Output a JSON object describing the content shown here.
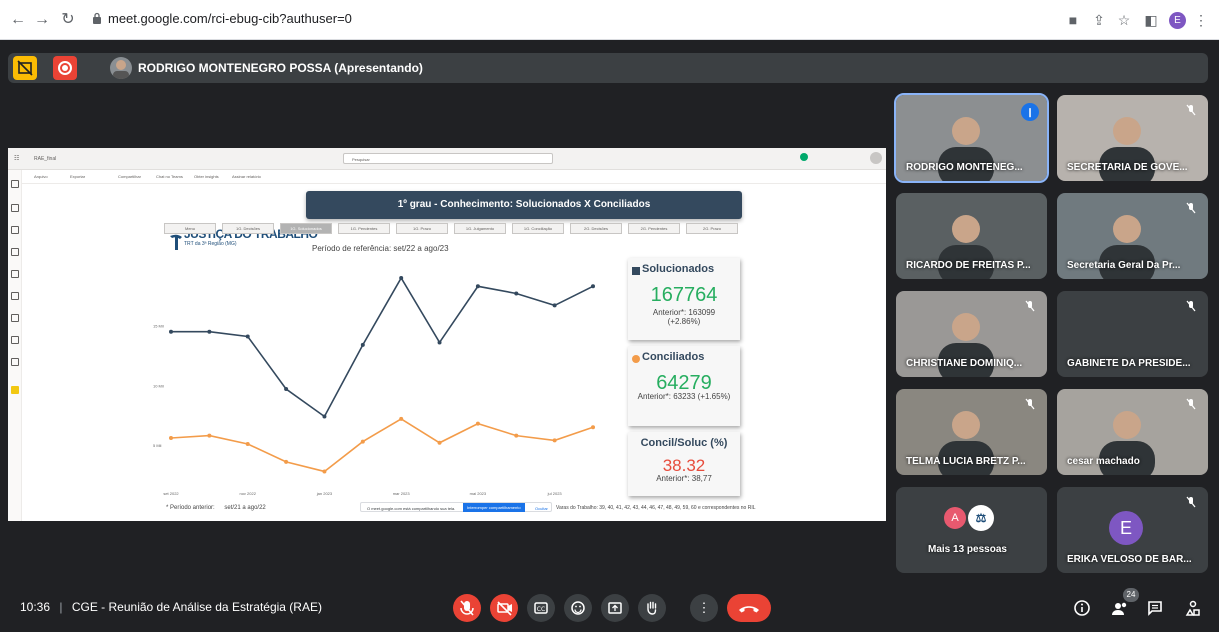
{
  "browser": {
    "url": "meet.google.com/rci-ebug-cib?authuser=0",
    "profile_initial": "E"
  },
  "presenter": {
    "label": "RODRIGO MONTENEGRO POSSA (Apresentando)"
  },
  "report": {
    "app_tab": "RAE_final",
    "search_placeholder": "Pesquisar",
    "toolbar_items": [
      "Arquivo",
      "Exportar",
      "Compartilhar",
      "Chat no Teams",
      "Obter insights",
      "Assinar relatório"
    ],
    "logo_title": "JUSTIÇA DO TRABALHO",
    "logo_subtitle": "TRT da 3ª Região (MG)",
    "header": "1º grau - Conhecimento: Solucionados X Conciliados",
    "tabs": [
      "Menu",
      "1G. Decisões",
      "1G. Solucionados",
      "1G. Pendentes",
      "1G. Prazo",
      "1G. Julgamento",
      "1G. Conciliação",
      "2G. Decisões",
      "2G. Pendentes",
      "2G. Prazo"
    ],
    "period_label": "Período de referência:",
    "period_value": "set/22 a ago/23",
    "anterior_label": "* Período anterior:",
    "anterior_value": "set/21 a ago/22",
    "footer_note": "Varas do Trabalho: 39, 40, 41, 42, 43, 44, 46, 47, 48, 49, 59, 60 e correspondentes no RIL",
    "share_notice": "O meet.google.com está compartilhando sua tela.",
    "share_stop": "Interromper compartilhamento",
    "share_hide": "Ocultar",
    "solucionados": {
      "title": "Solucionados",
      "value": "167764",
      "anterior": "Anterior*: 163099",
      "delta": "(+2.86%)"
    },
    "conciliados": {
      "title": "Conciliados",
      "value": "64279",
      "anterior": "Anterior*: 63233 (+1.65%)"
    },
    "ratio": {
      "title": "Concil/Soluc (%)",
      "value": "38.32",
      "anterior": "Anterior*: 38,77"
    },
    "colors": {
      "solucionados": "#34495e",
      "conciliados": "#f39c4a",
      "ratio": "#e74c3c",
      "green": "#27ae60"
    }
  },
  "chart_data": {
    "type": "line",
    "x": [
      "set 2022",
      "out 2022",
      "nov 2022",
      "dez 2022",
      "jan 2023",
      "fev 2023",
      "mar 2023",
      "abr 2023",
      "mai 2023",
      "jun 2023",
      "jul 2023",
      "ago 2023"
    ],
    "x_tick_labels": [
      "set 2022",
      "nov 2022",
      "jan 2023",
      "mar 2023",
      "mai 2023",
      "jul 2023"
    ],
    "y_tick_labels": [
      "5 Mil",
      "10 Mil",
      "15 Mil"
    ],
    "ylim": [
      2000,
      20000
    ],
    "series": [
      {
        "name": "Solucionados",
        "color": "#34495e",
        "values": [
          14500,
          14500,
          14100,
          9700,
          7400,
          13400,
          19000,
          13600,
          18300,
          17700,
          16700,
          18300
        ]
      },
      {
        "name": "Conciliados",
        "color": "#f39c4a",
        "values": [
          5600,
          5800,
          5100,
          3600,
          2800,
          5300,
          7200,
          5200,
          6800,
          5800,
          5400,
          6500
        ]
      }
    ]
  },
  "participants": [
    {
      "name": "RODRIGO MONTENEG...",
      "muted": false,
      "speaking": true
    },
    {
      "name": "SECRETARIA DE GOVE...",
      "muted": true
    },
    {
      "name": "RICARDO DE FREITAS P...",
      "muted": false
    },
    {
      "name": "Secretaria Geral Da Pr...",
      "muted": true
    },
    {
      "name": "CHRISTIANE DOMINIQ...",
      "muted": true
    },
    {
      "name": "GABINETE DA PRESIDE...",
      "muted": true
    },
    {
      "name": "TELMA LUCIA BRETZ P...",
      "muted": true
    },
    {
      "name": "cesar machado",
      "muted": true
    },
    {
      "name": "Mais 13 pessoas",
      "muted": false
    },
    {
      "name": "ERIKA VELOSO DE BAR...",
      "muted": true
    }
  ],
  "more_avatar_initial": "A",
  "erika_initial": "E",
  "bottom": {
    "time": "10:36",
    "separator": "|",
    "meeting_title": "CGE - Reunião de Análise da Estratégia (RAE)",
    "people_count": "24"
  }
}
